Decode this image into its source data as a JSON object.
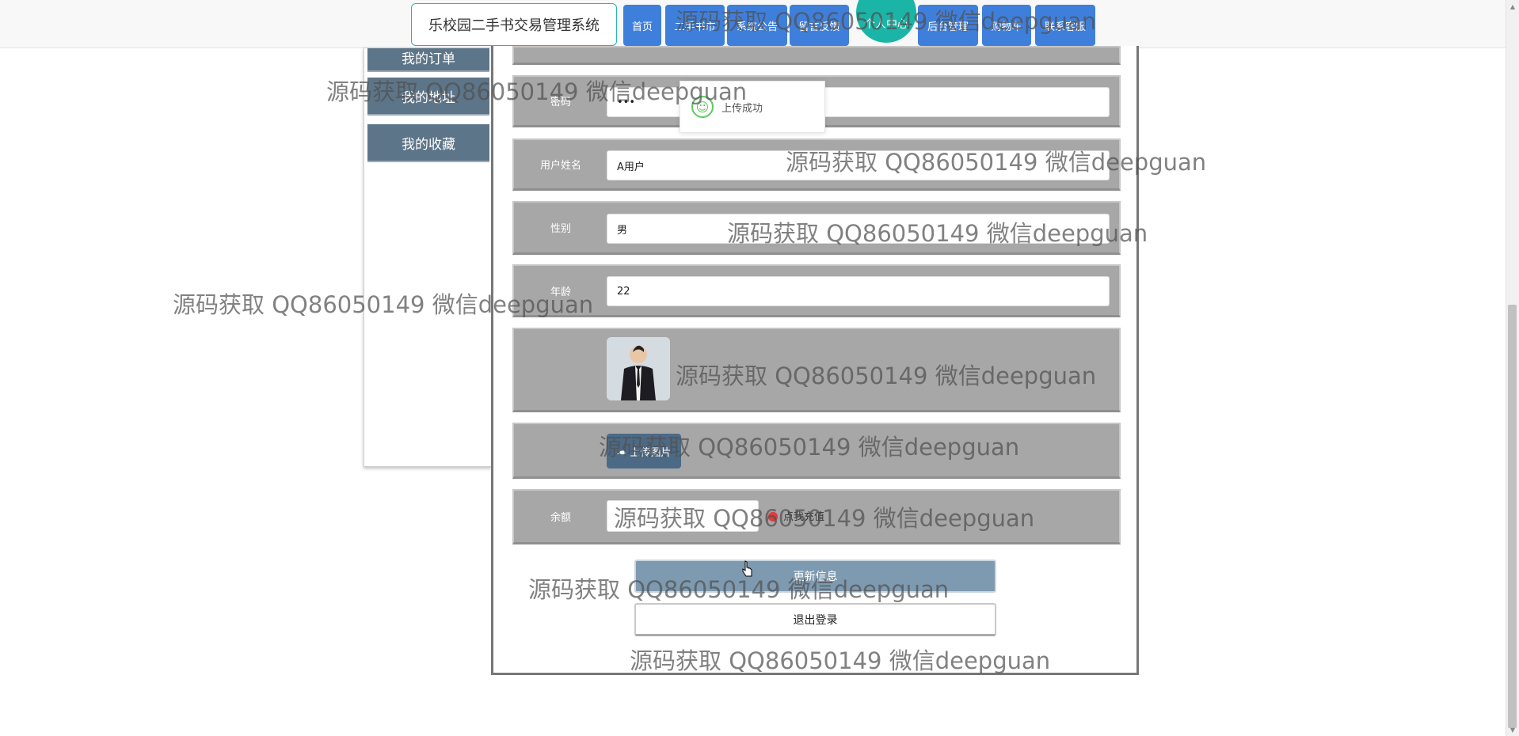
{
  "header": {
    "site_title": "乐校园二手书交易管理系统",
    "nav": [
      "首页",
      "二手书市",
      "系统公告",
      "留言反馈",
      "个人中心",
      "后台管理",
      "购物车",
      "联系客服"
    ]
  },
  "sidebar": {
    "items": [
      "我的订单",
      "我的地址",
      "我的收藏"
    ]
  },
  "form": {
    "password_label": "密码",
    "password_value": "•••",
    "name_label": "用户姓名",
    "name_value": "A用户",
    "gender_label": "性别",
    "gender_value": "男",
    "age_label": "年龄",
    "age_value": "22",
    "upload_label": "上传图片",
    "balance_label": "余额",
    "recharge_label": "点我充值",
    "update_button": "更新信息",
    "logout_button": "退出登录"
  },
  "toast": {
    "message": "上传成功"
  },
  "watermark": "源码获取 QQ86050149 微信deepguan",
  "colors": {
    "nav_blue": "#3f7fdc",
    "accent_teal": "#1ab5a6",
    "sidebar": "#5d7588",
    "row_gray": "#a7a7a7"
  }
}
